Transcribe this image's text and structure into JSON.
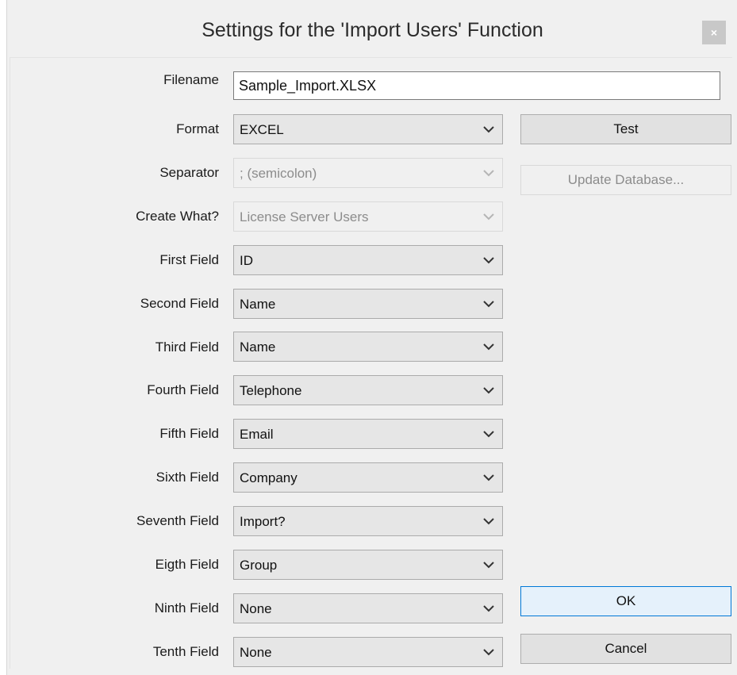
{
  "window": {
    "title": "Settings for the 'Import Users' Function",
    "close_label": "×"
  },
  "form": {
    "filename": {
      "label": "Filename",
      "value": "Sample_Import.XLSX"
    },
    "format": {
      "label": "Format",
      "value": "EXCEL"
    },
    "separator": {
      "label": "Separator",
      "value": "; (semicolon)",
      "enabled": false
    },
    "create_what": {
      "label": "Create What?",
      "value": "License Server Users",
      "enabled": false
    },
    "fields": [
      {
        "label": "First Field",
        "value": "ID"
      },
      {
        "label": "Second Field",
        "value": "Name"
      },
      {
        "label": "Third Field",
        "value": "Name"
      },
      {
        "label": "Fourth Field",
        "value": "Telephone"
      },
      {
        "label": "Fifth Field",
        "value": "Email"
      },
      {
        "label": "Sixth Field",
        "value": "Company"
      },
      {
        "label": "Seventh Field",
        "value": "Import?"
      },
      {
        "label": "Eigth Field",
        "value": "Group"
      },
      {
        "label": "Ninth Field",
        "value": "None"
      },
      {
        "label": "Tenth Field",
        "value": "None"
      }
    ]
  },
  "buttons": {
    "test": "Test",
    "update_database": "Update Database...",
    "ok": "OK",
    "cancel": "Cancel"
  },
  "icons": {
    "dropdown": "chevron-down-icon",
    "close": "close-icon"
  },
  "colors": {
    "dialog_bg": "#f0f0f0",
    "default_button_border": "#0078d7",
    "disabled_text": "#8c8c8c"
  }
}
